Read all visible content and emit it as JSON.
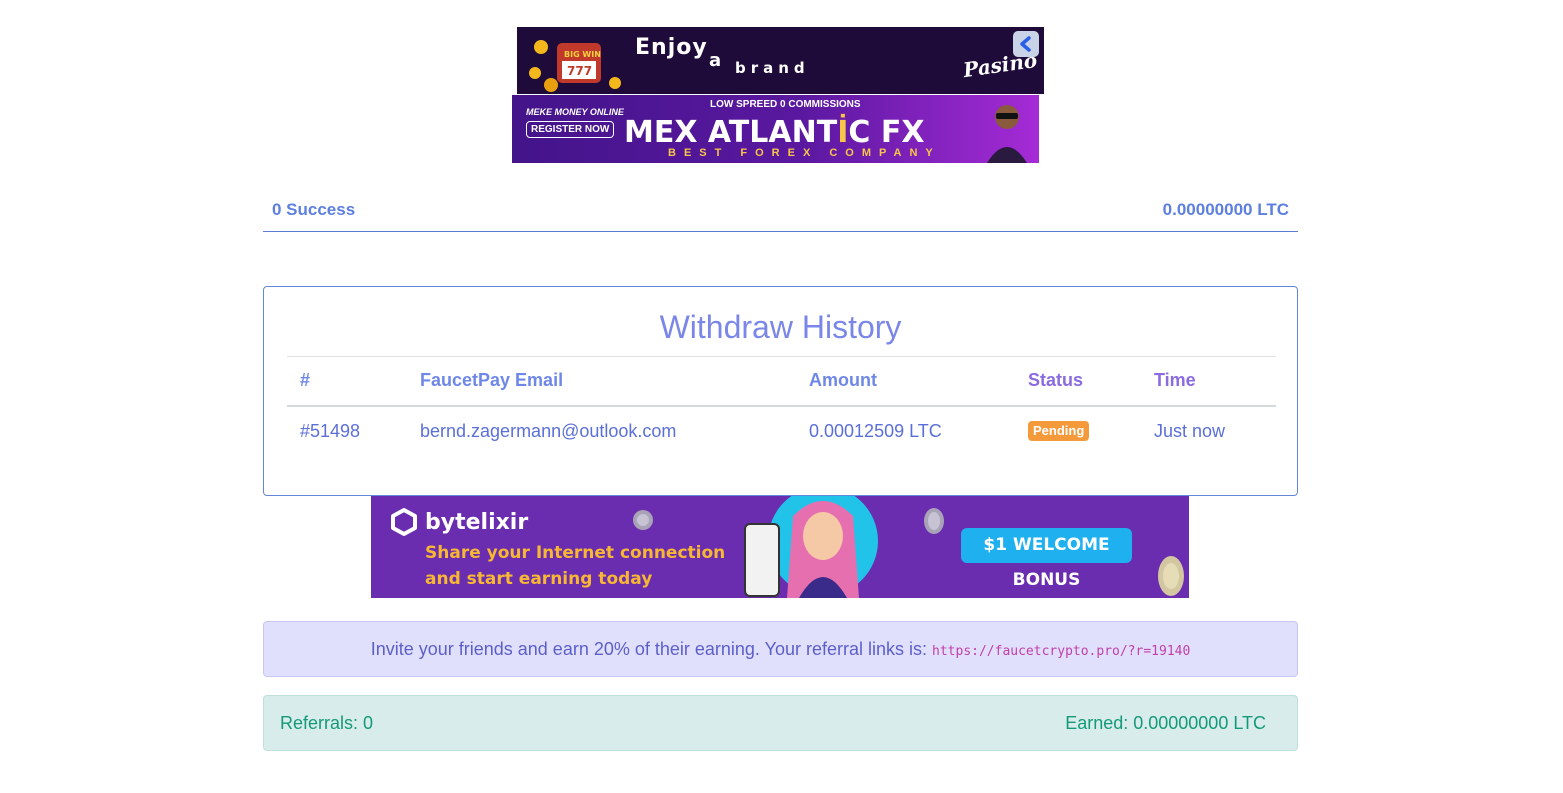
{
  "ads": {
    "pasino": {
      "headline_1": "Enjoy",
      "headline_2": "a",
      "headline_3": "brand",
      "brand": "Pasino",
      "coin_label": "BIG WIN"
    },
    "mex": {
      "tagline": "MEKE MONEY ONLINE",
      "register": "REGISTER NOW",
      "top_line": "LOW SPREED 0 COMMISSIONS",
      "name_white": "MEX ATLANT",
      "name_gold": "İ",
      "name_end": "C FX",
      "sub": "BEST FOREX COMPANY"
    },
    "bytelixir": {
      "name": "bytelixir",
      "line1": "Share your Internet connection",
      "line2": "and start earning today",
      "button": "$1  WELCOME BONUS"
    }
  },
  "stats": {
    "success": "0 Success",
    "balance": "0.00000000 LTC"
  },
  "withdraw": {
    "title": "Withdraw History",
    "columns": {
      "id": "#",
      "email": "FaucetPay Email",
      "amount": "Amount",
      "status": "Status",
      "time": "Time"
    },
    "rows": [
      {
        "id": "#51498",
        "email": "bernd.zagermann@outlook.com",
        "amount": "0.00012509 LTC",
        "status": "Pending",
        "time": "Just now"
      }
    ]
  },
  "referral": {
    "text": "Invite your friends and earn 20% of their earning. Your referral links is: ",
    "link": "https://faucetcrypto.pro/?r=19140",
    "referrals": "Referrals: 0",
    "earned": "Earned: 0.00000000 LTC"
  },
  "colors": {
    "accent": "#5c7fe0",
    "badge_pending": "#f59a3b",
    "alert_info_bg": "#e0e0fc",
    "alert_success_bg": "#d9ecec"
  }
}
